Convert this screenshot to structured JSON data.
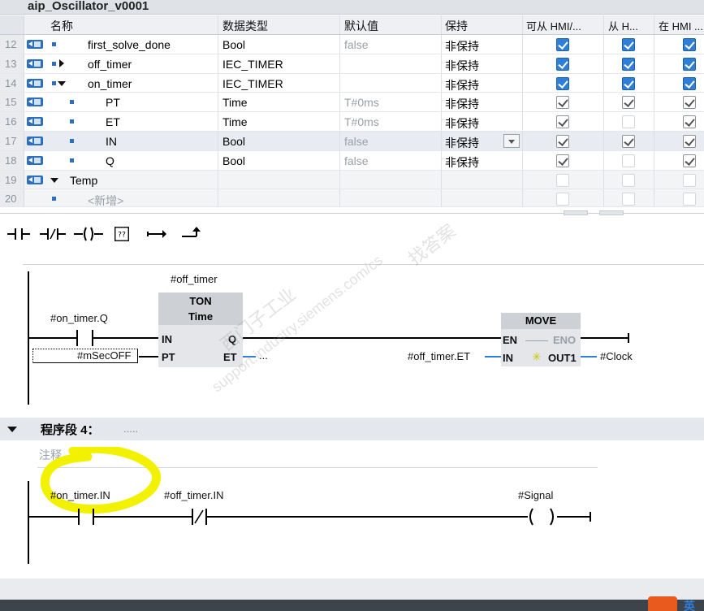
{
  "title": "aip_Oscillator_v0001",
  "table": {
    "headers": {
      "name": "名称",
      "dtype": "数据类型",
      "default": "默认值",
      "retain": "保持",
      "hmi_access": "可从 HMI/...",
      "from_hmi": "从 H...",
      "in_hmi": "在 HMI ..."
    },
    "rows": [
      {
        "num": "12",
        "name": "first_solve_done",
        "dtype": "Bool",
        "default": "false",
        "retain": "非保持"
      },
      {
        "num": "13",
        "name": "off_timer",
        "dtype": "IEC_TIMER",
        "default": "",
        "retain": "非保持"
      },
      {
        "num": "14",
        "name": "on_timer",
        "dtype": "IEC_TIMER",
        "default": "",
        "retain": "非保持"
      },
      {
        "num": "15",
        "name": "PT",
        "dtype": "Time",
        "default": "T#0ms",
        "retain": "非保持"
      },
      {
        "num": "16",
        "name": "ET",
        "dtype": "Time",
        "default": "T#0ms",
        "retain": "非保持"
      },
      {
        "num": "17",
        "name": "IN",
        "dtype": "Bool",
        "default": "false",
        "retain": "非保持"
      },
      {
        "num": "18",
        "name": "Q",
        "dtype": "Bool",
        "default": "false",
        "retain": "非保持"
      },
      {
        "num": "19",
        "name": "Temp",
        "dtype": "",
        "default": "",
        "retain": ""
      },
      {
        "num": "20",
        "name": "<新增>",
        "dtype": "",
        "default": "",
        "retain": ""
      }
    ]
  },
  "network3": {
    "ton_instance": "#off_timer",
    "ton_title": "TON",
    "ton_type": "Time",
    "contact_tag": "#on_timer.Q",
    "pt_tag": "#mSecOFF",
    "pin_in": "IN",
    "pin_q": "Q",
    "pin_pt": "PT",
    "pin_et": "ET",
    "et_out": "...",
    "move_title": "MOVE",
    "move_en": "EN",
    "move_eno": "ENO",
    "move_in": "IN",
    "move_out": "OUT1",
    "move_in_tag": "#off_timer.ET",
    "move_out_tag": "#Clock"
  },
  "segment4": {
    "label": "程序段 4：",
    "dots": "....."
  },
  "comment_placeholder": "注释",
  "network4": {
    "contact1_tag": "#on_timer.IN",
    "contact2_tag": "#off_timer.IN",
    "coil_tag": "#Signal"
  },
  "watermark": [
    "找答案",
    "西门子工业",
    "support.industry.siemens.com/cs"
  ],
  "colors": {
    "highlight": "#f2f200",
    "accent": "#2f7ed8"
  }
}
